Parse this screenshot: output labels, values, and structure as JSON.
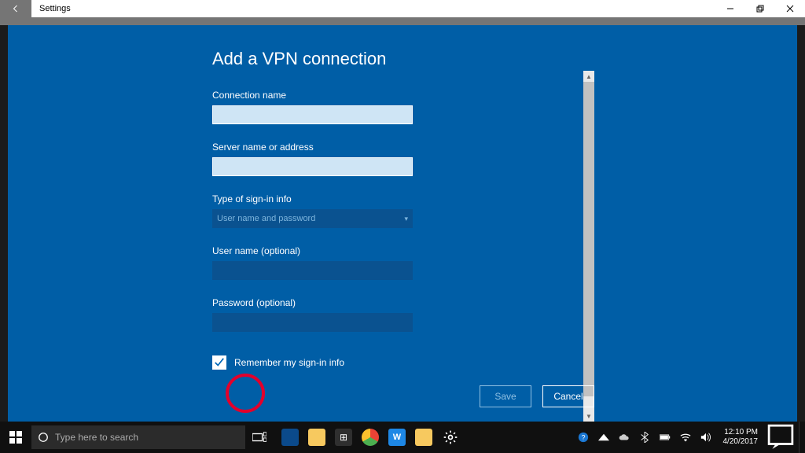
{
  "window": {
    "title": "Settings"
  },
  "dialog": {
    "title": "Add a VPN connection",
    "fields": {
      "connection_name": {
        "label": "Connection name",
        "value": ""
      },
      "server": {
        "label": "Server name or address",
        "value": ""
      },
      "signin_type": {
        "label": "Type of sign-in info",
        "selected": "User name and password"
      },
      "username": {
        "label": "User name (optional)",
        "value": ""
      },
      "password": {
        "label": "Password (optional)",
        "value": ""
      }
    },
    "remember": {
      "label": "Remember my sign-in info",
      "checked": true
    },
    "buttons": {
      "save": "Save",
      "cancel": "Cancel"
    }
  },
  "taskbar": {
    "search_placeholder": "Type here to search",
    "clock": {
      "time": "12:10 PM",
      "date": "4/20/2017"
    }
  },
  "colors": {
    "accent": "#005ea6",
    "highlight": "#e3002b"
  }
}
